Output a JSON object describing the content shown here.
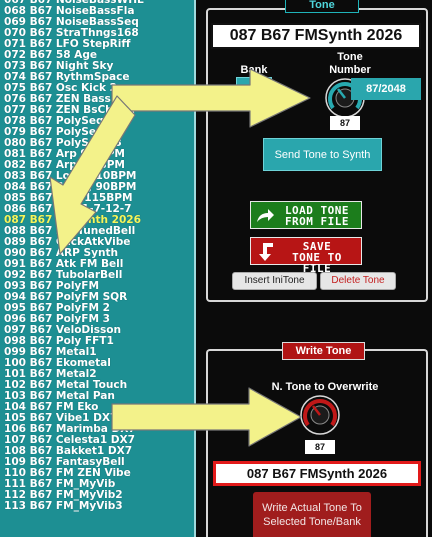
{
  "tone_list": {
    "selected_index": 20,
    "items": [
      "067 B67 NoiseBassWHL",
      "068 B67 NoiseBassFla",
      "069 B67 NoiseBassSeq",
      "070 B67 StraThngs168",
      "071 B67 LFO StepRiff",
      "072 B67 58 Age",
      "073 B67 Night Sky",
      "074 B67 RythmSpace",
      "075 B67 Osc Kick 2",
      "076 B67 ZEN BassSeq",
      "077 B67 ZEN BsChSeq",
      "078 B67 PolySeq 01",
      "079 B67 PolySeq 02",
      "080 B67 PolySeq 03",
      "081 B67 Arp 92 BPM",
      "082 B67 Arp 72 BPM",
      "083 B67 Loop 110BPM",
      "084 B67 Swing 90BPM",
      "085 B67 KNC 115BPM",
      "086 B67 Seq 1-7-12-7",
      "087 B67 FMSynth 2026",
      "088 B67 FM TunedBell",
      "089 B67 ClickAtkVibe",
      "090 B67 ARP Synth",
      "091 B67 Atk FM Bell",
      "092 B67 TubolarBell",
      "093 B67 PolyFM",
      "094 B67 PolyFM SQR",
      "095 B67 PolyFM 2",
      "096 B67 PolyFM 3",
      "097 B67 VeloDisson",
      "098 B67 Poly FFT1",
      "099 B67 Metal1",
      "100 B67 Ekometal",
      "101 B67 Metal2",
      "102 B67 Metal Touch",
      "103 B67 Metal Pan",
      "104 B67 FM Eko",
      "105 B67 Vibe1 DX7",
      "106 B67 Marimba DX7",
      "107 B67 Celesta1 DX7",
      "108 B67 Bakket1 DX7",
      "109 B67 FantasyBell",
      "110 B67 FM ZEN Vibe",
      "111 B67 FM_MyVib",
      "112 B67 FM_MyVib2",
      "113 B67 FM_MyVib3"
    ]
  },
  "tone_panel": {
    "tab_label": "Tone",
    "current_tone_name": "087 B67 FMSynth 2026",
    "tone_label": "Tone",
    "bank_label": "Bank",
    "number_label": "Number",
    "knob_value": "87",
    "number_display": "87/2048",
    "send_button": "Send Tone to Synth",
    "load_button_line1": "LOAD TONE",
    "load_button_line2": "FROM FILE",
    "save_button_line1": "SAVE",
    "save_button_line2": "TONE TO FILE",
    "insert_button": "Insert IniTone",
    "delete_button": "Delete Tone"
  },
  "write_panel": {
    "tab_label": "Write Tone",
    "overwrite_label": "N. Tone to Overwrite",
    "knob_value": "87",
    "target_tone_name": "087 B67 FMSynth 2026",
    "write_button_line1": "Write Actual Tone To",
    "write_button_line2": "Selected Tone/Bank"
  },
  "colors": {
    "list_bg": "#1d8f93",
    "selected_item": "#f6f55a",
    "accent_teal": "#2aa6ad",
    "write_red": "#b01414",
    "arrow_yellow": "#f3f28a"
  }
}
